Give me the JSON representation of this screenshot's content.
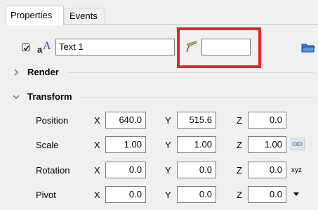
{
  "tabs": [
    {
      "label": "Properties",
      "active": true
    },
    {
      "label": "Events",
      "active": false
    }
  ],
  "name_row": {
    "checkbox_checked": true,
    "text_icon_glyph": "aA",
    "name_value": "Text 1",
    "brush_icon": "brush-icon",
    "color_value": "",
    "folder_icon": "folder-icon"
  },
  "sections": {
    "render": {
      "label": "Render",
      "expanded": false
    },
    "transform": {
      "label": "Transform",
      "expanded": true
    }
  },
  "transform_rows": [
    {
      "label": "Position",
      "x": "640.0",
      "y": "515.6",
      "z": "0.0",
      "extra": ""
    },
    {
      "label": "Scale",
      "x": "1.00",
      "y": "1.00",
      "z": "1.00",
      "extra": "link"
    },
    {
      "label": "Rotation",
      "x": "0.0",
      "y": "0.0",
      "z": "0.0",
      "extra": "xyz"
    },
    {
      "label": "Pivot",
      "x": "0.0",
      "y": "0.0",
      "z": "0.0",
      "extra": "dropdown"
    }
  ],
  "axis_labels": {
    "x": "X",
    "y": "Y",
    "z": "Z"
  },
  "colors": {
    "highlight": "#e0262a",
    "background": "#f0f0f0"
  }
}
